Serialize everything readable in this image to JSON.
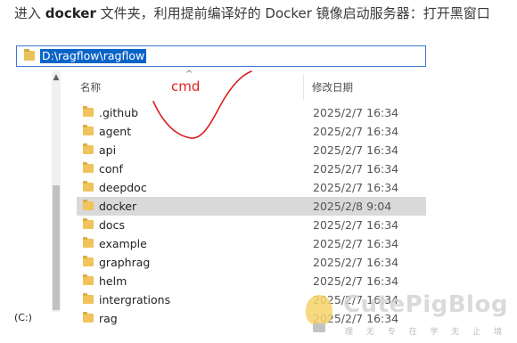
{
  "intro": {
    "prefix": "进入 ",
    "bold": "docker",
    "suffix": " 文件夹，利用提前编译好的 Docker 镜像启动服务器：打开黑窗口"
  },
  "explorer": {
    "address": "D:\\ragflow\\ragflow",
    "columns": {
      "name": "名称",
      "date": "修改日期"
    },
    "drive_label": "(C:)",
    "rows": [
      {
        "name": ".github",
        "date": "2025/2/7 16:34",
        "selected": false
      },
      {
        "name": "agent",
        "date": "2025/2/7 16:34",
        "selected": false
      },
      {
        "name": "api",
        "date": "2025/2/7 16:34",
        "selected": false
      },
      {
        "name": "conf",
        "date": "2025/2/7 16:34",
        "selected": false
      },
      {
        "name": "deepdoc",
        "date": "2025/2/7 16:34",
        "selected": false
      },
      {
        "name": "docker",
        "date": "2025/2/8 9:04",
        "selected": true
      },
      {
        "name": "docs",
        "date": "2025/2/7 16:34",
        "selected": false
      },
      {
        "name": "example",
        "date": "2025/2/7 16:34",
        "selected": false
      },
      {
        "name": "graphrag",
        "date": "2025/2/7 16:34",
        "selected": false
      },
      {
        "name": "helm",
        "date": "2025/2/7 16:34",
        "selected": false
      },
      {
        "name": "intergrations",
        "date": "2025/2/7 16:34",
        "selected": false
      },
      {
        "name": "rag",
        "date": "2025/2/7 16:34",
        "selected": false
      }
    ]
  },
  "annotation": {
    "text": "cmd",
    "color": "#e01f1f"
  },
  "watermark": {
    "title": "CutePigBlog",
    "subtitle": "理 无 专 在 学 无 止 境"
  },
  "colors": {
    "selection": "#d9d9d9",
    "address_highlight": "#0a64c8",
    "folder": "#f1c35b"
  }
}
